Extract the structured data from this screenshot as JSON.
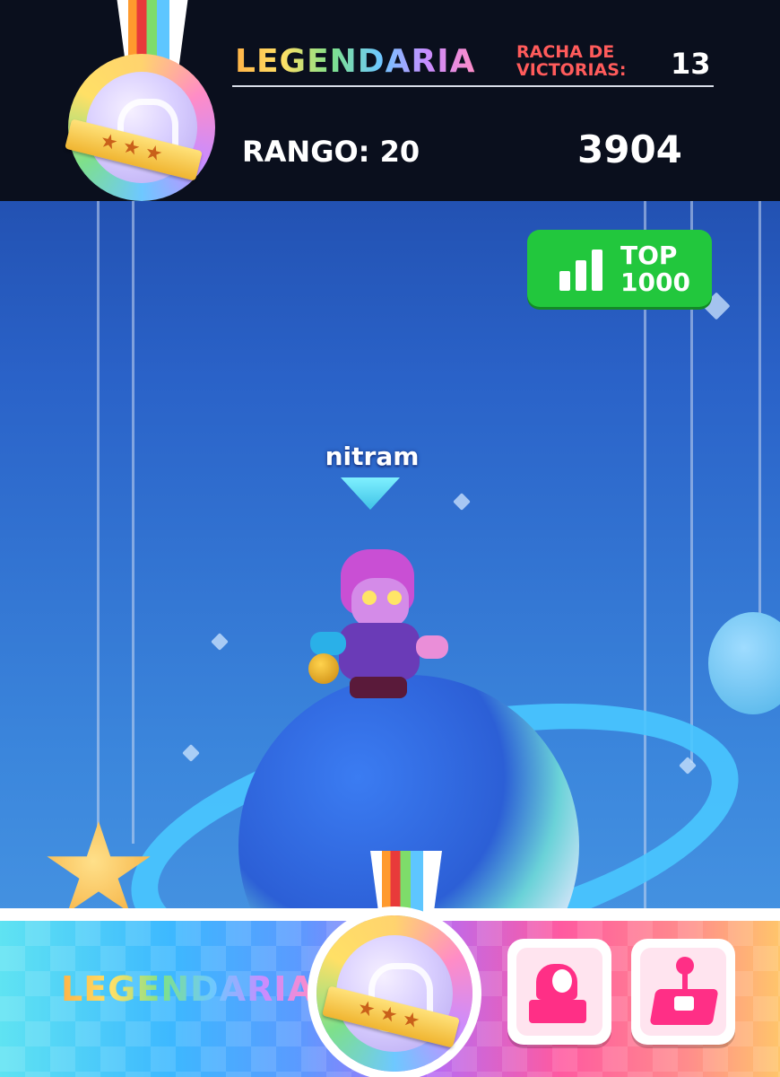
{
  "header": {
    "rank_tier": "LEGENDARIA",
    "win_streak_label": "RACHA DE\nVICTORIAS:",
    "win_streak_value": "13",
    "rank_label": "RANGO: 20",
    "trophies": "3904"
  },
  "leaderboard_badge": {
    "icon": "bar-chart-icon",
    "label": "TOP\n1000",
    "color": "#22c73d"
  },
  "player": {
    "name": "nitram"
  },
  "bottom_bar": {
    "rank_tier": "LEGENDARIA",
    "buttons": [
      {
        "icon": "cannon-icon"
      },
      {
        "icon": "joystick-icon"
      }
    ]
  },
  "colors": {
    "accent_pink": "#ff2f86",
    "streak_red": "#ff5b5b",
    "header_bg": "#0a0f1d"
  }
}
